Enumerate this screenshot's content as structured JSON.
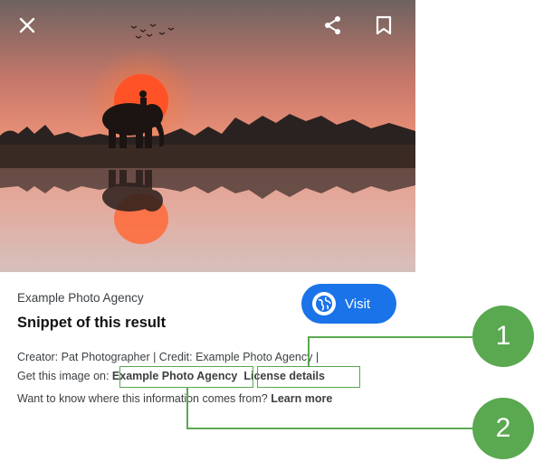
{
  "photo": {
    "alt": "Silhouette of a person riding an elephant at sunset, reflected in water",
    "sky_top": "#7f6d6a",
    "sky_glow": "#e8836b",
    "sun": "#ff5a2c",
    "water": "#d9a79c"
  },
  "overlay": {
    "close_icon": "close-icon",
    "share_icon": "share-icon",
    "bookmark_icon": "bookmark-icon"
  },
  "result": {
    "source": "Example Photo Agency",
    "title": "Snippet of this result",
    "visit_label": "Visit",
    "creator_line": "Creator: Pat Photographer | Credit: Example Photo Agency |",
    "get_image_prefix": "Get this image on: ",
    "agency_link": "Example Photo Agency",
    "license_link": "License details",
    "info_prefix": "Want to know where this information comes from? ",
    "learn_more": "Learn more"
  },
  "callouts": [
    {
      "label": "1"
    },
    {
      "label": "2"
    }
  ],
  "colors": {
    "accent": "#1a73e8",
    "callout": "#5aa850"
  }
}
